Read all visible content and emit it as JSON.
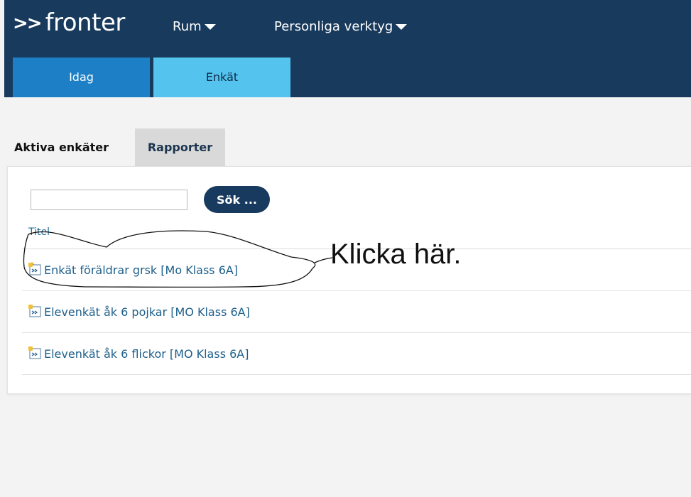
{
  "header": {
    "logo_arrows": ">>",
    "logo_text": "fronter",
    "menus": [
      {
        "label": "Rum"
      },
      {
        "label": "Personliga verktyg"
      }
    ],
    "nav_tabs": [
      {
        "label": "Idag"
      },
      {
        "label": "Enkät"
      }
    ]
  },
  "content_tabs": [
    {
      "label": "Aktiva enkäter"
    },
    {
      "label": "Rapporter"
    }
  ],
  "search": {
    "value": "",
    "button_label": "Sök ..."
  },
  "table": {
    "column_title": "Titel",
    "rows": [
      {
        "title": "Enkät föräldrar grsk [Mo Klass 6A]",
        "icon": "survey-icon"
      },
      {
        "title": "Elevenkät åk 6 pojkar [MO Klass 6A]",
        "icon": "survey-icon"
      },
      {
        "title": "Elevenkät åk 6 flickor [MO Klass 6A]",
        "icon": "survey-icon"
      }
    ]
  },
  "annotation": {
    "text": "Klicka här."
  },
  "colors": {
    "topbar": "#183a5c",
    "tab_idag": "#1d80c6",
    "tab_enkat": "#54c4ef",
    "search_button": "#173a5e",
    "link": "#1d5f8a"
  }
}
